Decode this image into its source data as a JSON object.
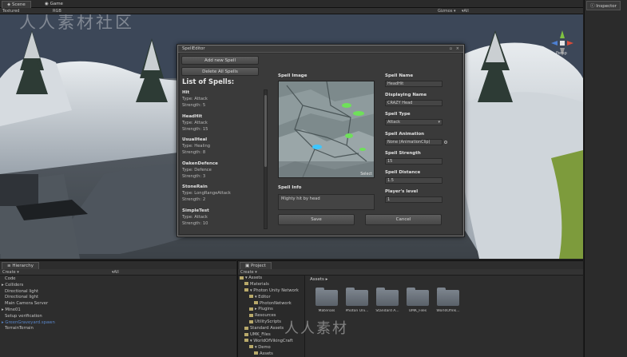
{
  "tabs": {
    "scene": "Scene",
    "game": "Game",
    "inspector": "Inspector",
    "hierarchy": "Hierarchy",
    "project": "Project"
  },
  "scene_toolbar": {
    "mode": "Textured",
    "rgb": "RGB",
    "gizmos": "Gizmos ▾",
    "search": "▾All"
  },
  "watermark": "人人素材社区",
  "watermark2": "人人素材",
  "gizmo": {
    "label": "Persp"
  },
  "spell_editor": {
    "title": "SpellEditor",
    "add_button": "Add new Spell",
    "delete_button": "Delete All Spells",
    "list_title": "List of Spells:",
    "spells": [
      {
        "name": "Hit",
        "type": "Type: Attack",
        "strength": "Strength: 5"
      },
      {
        "name": "HeadHit",
        "type": "Type: Attack",
        "strength": "Strength: 15"
      },
      {
        "name": "UsualHeal",
        "type": "Type: Healing",
        "strength": "Strength: 8"
      },
      {
        "name": "OakenDefence",
        "type": "Type: Defence",
        "strength": "Strength: 3"
      },
      {
        "name": "StoneRain",
        "type": "Type: LongRangeAttack",
        "strength": "Strength: 2"
      },
      {
        "name": "SimpleTest",
        "type": "Type: Attack",
        "strength": "Strength: 10"
      }
    ],
    "image_label": "Spell Image",
    "select_label": "Select",
    "info_label": "Spell Info",
    "info_value": "Mighty hit by head",
    "fields": {
      "name_label": "Spell Name",
      "name_value": "HeadHit",
      "display_label": "Displaying Name",
      "display_value": "CRAZY Head",
      "type_label": "Spell Type",
      "type_value": "Attack",
      "anim_label": "Spell Animation",
      "anim_value": "None (AnimationClip)",
      "strength_label": "Spell Strength",
      "strength_value": "15",
      "distance_label": "Spell Distance",
      "distance_value": "1.5",
      "level_label": "Player's level",
      "level_value": "1"
    },
    "save_button": "Save",
    "cancel_button": "Cancel"
  },
  "hierarchy": {
    "create": "Create ▾",
    "search": "▾All",
    "items": [
      {
        "label": "Code",
        "indent": 1
      },
      {
        "label": "▸ Colliders",
        "indent": 0
      },
      {
        "label": "Directional light",
        "indent": 1
      },
      {
        "label": "Directional light",
        "indent": 1
      },
      {
        "label": "Main Camera Server",
        "indent": 1
      },
      {
        "label": "▸ Mine01",
        "indent": 0
      },
      {
        "label": "Setup verification",
        "indent": 1
      },
      {
        "label": "▸ GreenGraveyard.spawn",
        "indent": 0,
        "selected": true
      },
      {
        "label": "TerrainTerrain",
        "indent": 1
      }
    ]
  },
  "project": {
    "create": "Create ▾",
    "breadcrumb": "Assets ▸",
    "tree": [
      {
        "label": "▾ Assets",
        "indent": 0
      },
      {
        "label": "Materials",
        "indent": 1
      },
      {
        "label": "▾ Photon Unity Network",
        "indent": 1
      },
      {
        "label": "▾ Editor",
        "indent": 2
      },
      {
        "label": "PhotonNetwork",
        "indent": 3
      },
      {
        "label": "▸ Plugins",
        "indent": 2
      },
      {
        "label": "Resources",
        "indent": 2
      },
      {
        "label": "UtilityScripts",
        "indent": 2
      },
      {
        "label": "Standard Assets",
        "indent": 1
      },
      {
        "label": "UMK_Files",
        "indent": 1
      },
      {
        "label": "▾ WorldOfVikingCraft",
        "indent": 1
      },
      {
        "label": "▾ Demo",
        "indent": 2
      },
      {
        "label": "Assets",
        "indent": 3
      }
    ],
    "folders": [
      "Materials",
      "Photon Uni...",
      "Standard A...",
      "UMK_Files",
      "WorldOfVik..."
    ]
  }
}
